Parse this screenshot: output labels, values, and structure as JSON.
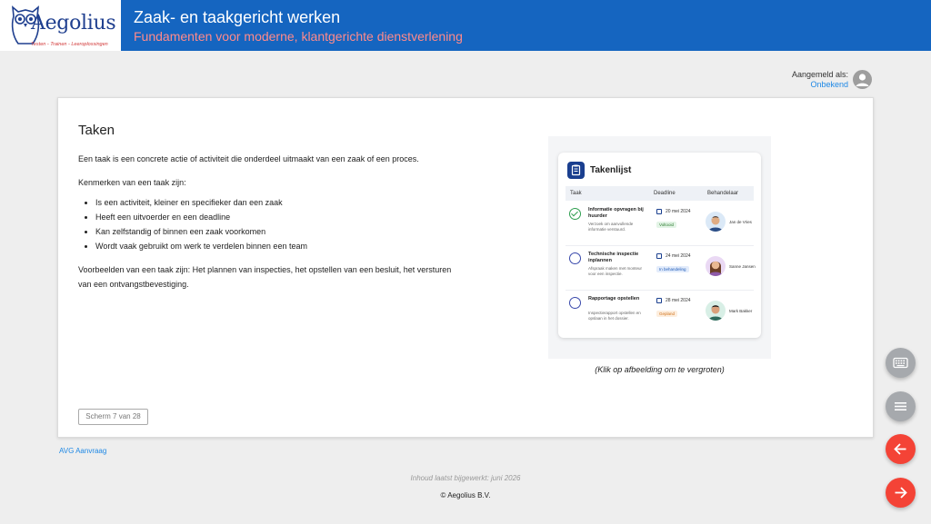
{
  "header": {
    "logo_text": "Aegolius",
    "logo_subtitle": "Testen - Trainen - Leeroplossingen",
    "title": "Zaak- en taakgericht werken",
    "subtitle": "Fundamenten voor moderne, klantgerichte dienstverlening"
  },
  "login": {
    "label": "Aangemeld als:",
    "user": "Onbekend"
  },
  "main": {
    "heading": "Taken",
    "intro": "Een taak is een concrete actie of activiteit die onderdeel uitmaakt van een zaak of een proces.",
    "features_intro": "Kenmerken van een taak zijn:",
    "features": [
      "Is een activiteit, kleiner en specifieker dan een zaak",
      "Heeft een uitvoerder en een deadline",
      "Kan zelfstandig of binnen een zaak voorkomen",
      "Wordt vaak gebruikt om werk te verdelen binnen een team"
    ],
    "examples": "Voorbeelden van een taak zijn: Het plannen van inspecties, het opstellen van een besluit, het versturen van een ontvangstbevestiging.",
    "screen_counter": "Scherm 7 van 28",
    "image_caption": "(Klik op afbeelding om te vergroten)"
  },
  "takenlijst": {
    "title": "Takenlijst",
    "columns": [
      "Taak",
      "Deadline",
      "Behandelaar"
    ],
    "rows": [
      {
        "name": "Informatie opvragen bij huurder",
        "desc": "Verzoek om aanvullende informatie verstuurd.",
        "date": "20 mei 2024",
        "status": "Voltooid",
        "person": "Jan de Vries",
        "done": true
      },
      {
        "name": "Technische inspectie inplannen",
        "desc": "Afspraak maken met monteur voor een inspectie.",
        "date": "24 mei 2024",
        "status": "In behandeling",
        "person": "Sanne Jansen",
        "done": false
      },
      {
        "name": "Rapportage opstellen",
        "desc": "Inspectierapport opstellen en opslaan in het dossier.",
        "date": "28 mei 2024",
        "status": "Gepland",
        "person": "Mark Bakker",
        "done": false
      }
    ]
  },
  "footer": {
    "avg_link": "AVG Aanvraag",
    "updated": "Inhoud laatst bijgewerkt: juni 2026",
    "copyright": "© Aegolius B.V."
  },
  "fabs": [
    "keyboard-icon",
    "menu-icon",
    "arrow-left-icon",
    "arrow-right-icon"
  ],
  "colors": {
    "header_bg": "#1565c0",
    "subtitle": "#ff8a8a",
    "link": "#1e88e5",
    "fab_grey": "#a6a9ad",
    "fab_red": "#f44336"
  }
}
